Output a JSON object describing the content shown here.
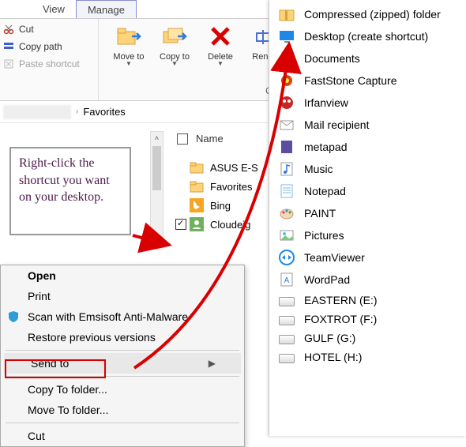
{
  "ribbon": {
    "tab_view": "View",
    "tab_manage": "Manage",
    "cut": "Cut",
    "copy_path": "Copy path",
    "paste_shortcut": "Paste shortcut",
    "move_to": "Move to",
    "copy_to": "Copy to",
    "delete": "Delete",
    "rename": "Renam",
    "organize": "Organize"
  },
  "breadcrumb": {
    "favorites": "Favorites"
  },
  "list": {
    "header_name": "Name",
    "items": [
      {
        "label": "ASUS E-S"
      },
      {
        "label": "Favorites"
      },
      {
        "label": "Bing"
      },
      {
        "label": "Cloudeig"
      }
    ]
  },
  "instruction": "Right-click the shortcut you want on your desktop.",
  "context_menu": {
    "open": "Open",
    "print": "Print",
    "scan": "Scan with Emsisoft Anti-Malware",
    "restore": "Restore previous versions",
    "send_to": "Send to",
    "copy_to": "Copy To folder...",
    "move_to": "Move To folder...",
    "cut": "Cut"
  },
  "sendto": [
    {
      "label": "Compressed (zipped) folder",
      "icon": "zip"
    },
    {
      "label": "Desktop (create shortcut)",
      "icon": "desktop"
    },
    {
      "label": "Documents",
      "icon": "doc"
    },
    {
      "label": "FastStone Capture",
      "icon": "fsc"
    },
    {
      "label": "Irfanview",
      "icon": "irfan"
    },
    {
      "label": "Mail recipient",
      "icon": "mail"
    },
    {
      "label": "metapad",
      "icon": "metapad"
    },
    {
      "label": "Music",
      "icon": "music"
    },
    {
      "label": "Notepad",
      "icon": "notepad"
    },
    {
      "label": "PAINT",
      "icon": "paint"
    },
    {
      "label": "Pictures",
      "icon": "pics"
    },
    {
      "label": "TeamViewer",
      "icon": "tv"
    },
    {
      "label": "WordPad",
      "icon": "wordpad"
    },
    {
      "label": "EASTERN (E:)",
      "icon": "drive"
    },
    {
      "label": "FOXTROT (F:)",
      "icon": "drive"
    },
    {
      "label": "GULF (G:)",
      "icon": "drive"
    },
    {
      "label": "HOTEL (H:)",
      "icon": "drive"
    }
  ]
}
